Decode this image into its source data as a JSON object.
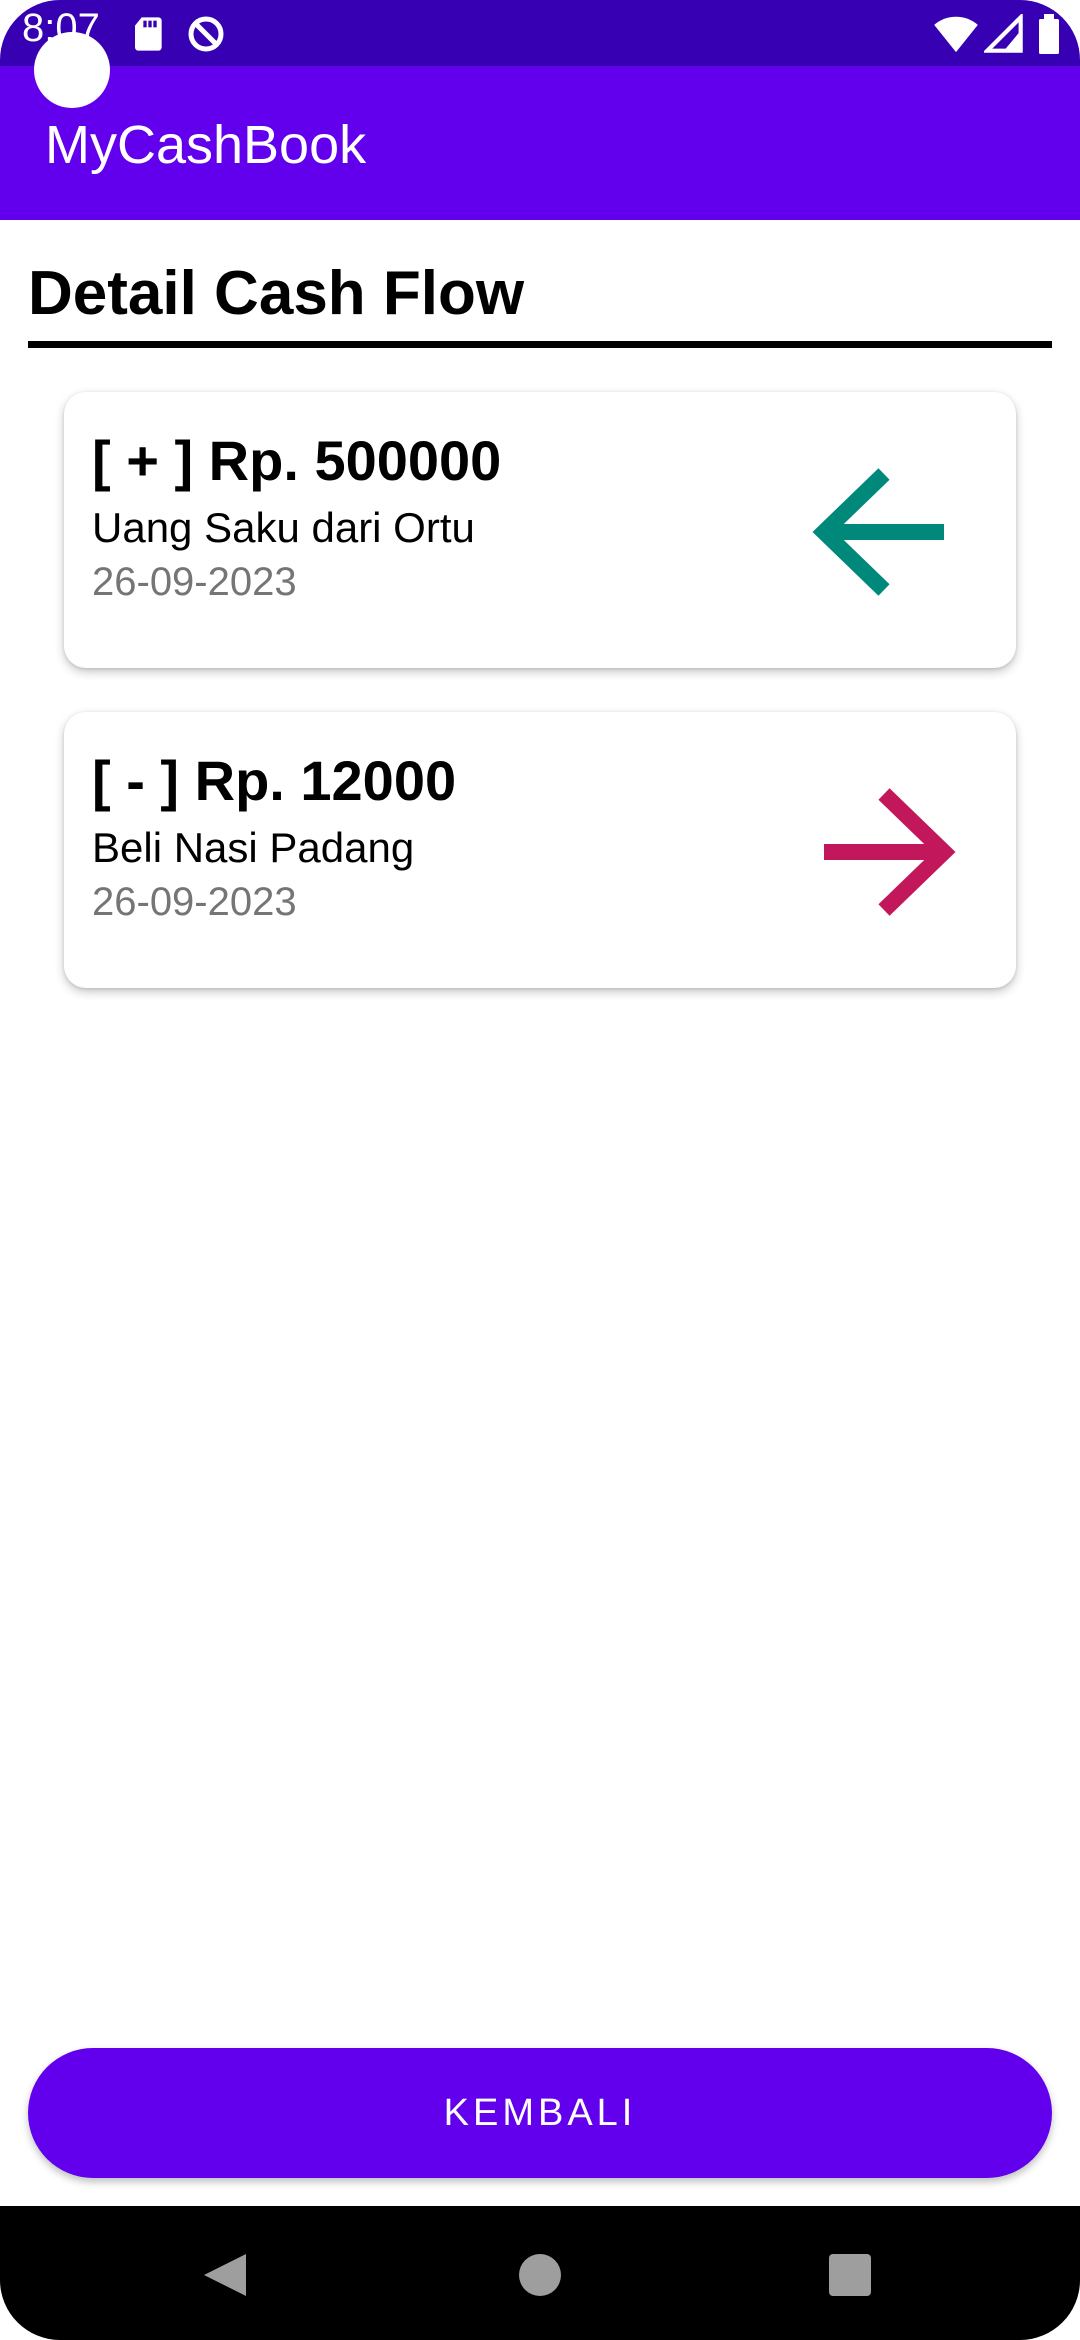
{
  "status_bar": {
    "time": "8:07",
    "icons": [
      "sd-card-icon",
      "do-not-disturb-icon",
      "wifi-icon",
      "cellular-signal-icon",
      "battery-icon"
    ]
  },
  "app_bar": {
    "title": "MyCashBook"
  },
  "page": {
    "heading": "Detail Cash Flow"
  },
  "transactions": [
    {
      "amount": "[ + ] Rp. 500000",
      "description": "Uang Saku dari Ortu",
      "date": "26-09-2023",
      "type": "income",
      "arrow_icon": "arrow-left-icon",
      "arrow_color": "#00897b"
    },
    {
      "amount": "[ - ] Rp. 12000",
      "description": "Beli Nasi Padang",
      "date": "26-09-2023",
      "type": "expense",
      "arrow_icon": "arrow-right-icon",
      "arrow_color": "#c2185b"
    }
  ],
  "actions": {
    "back_label": "KEMBALI"
  },
  "nav_bar": {
    "buttons": [
      "back-nav-icon",
      "home-nav-icon",
      "recents-nav-icon"
    ]
  },
  "colors": {
    "primary": "#6200ee",
    "primary_dark": "#3700b3",
    "income": "#00897b",
    "expense": "#c2185b",
    "date_text": "#757575"
  }
}
